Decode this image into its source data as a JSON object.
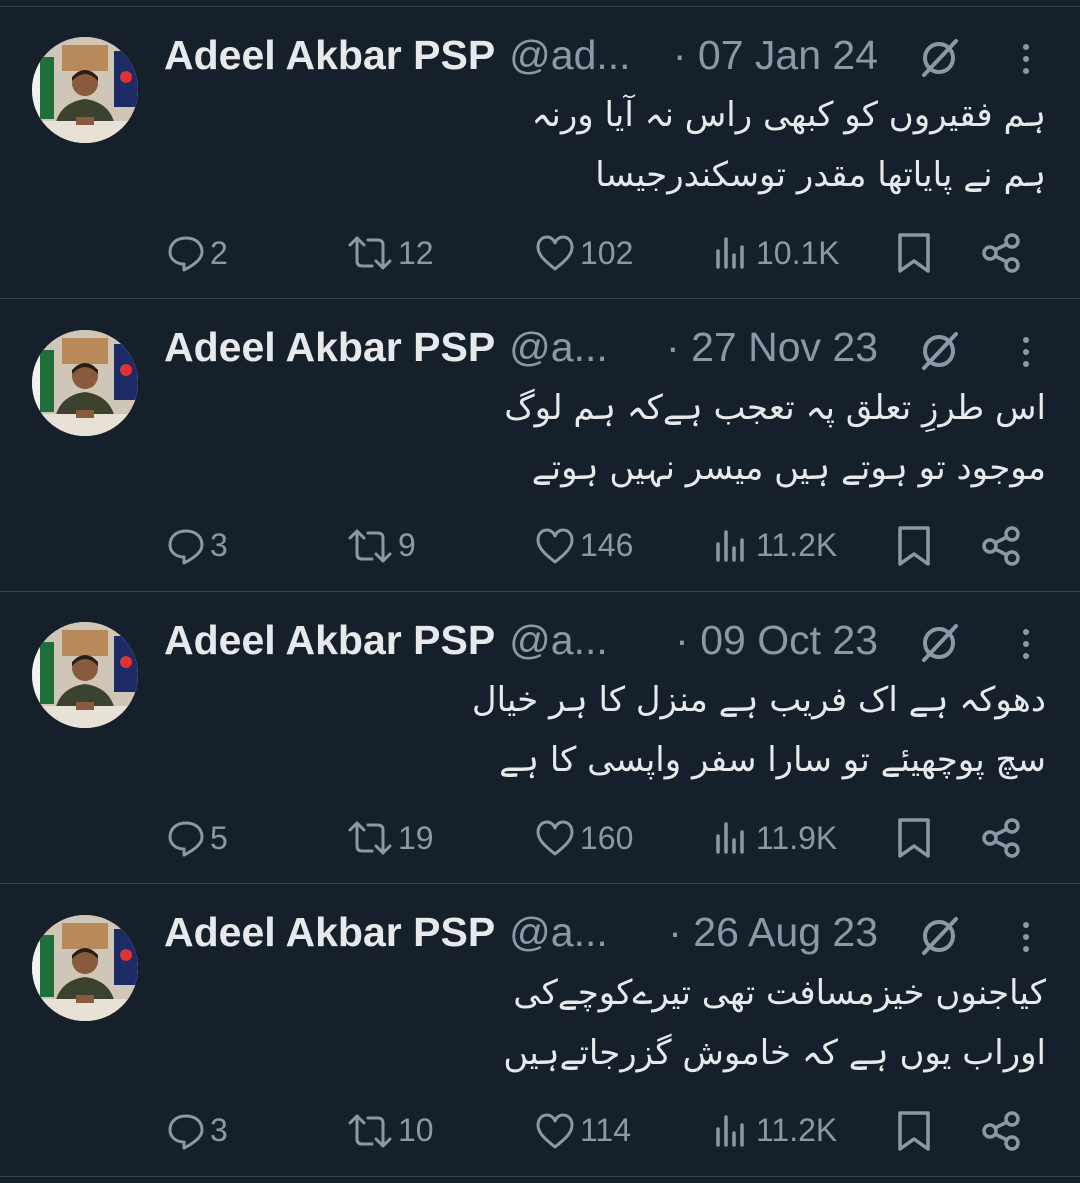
{
  "tweets": [
    {
      "name": "Adeel Akbar PSP",
      "handle": "@ad...",
      "date": "· 07 Jan 24",
      "lines": [
        "ہم فقیروں کو کبھی راس نہ آیا ورنہ",
        "ہم نے پایاتھا مقدر توسکندرجیسا"
      ],
      "replies": "2",
      "retweets": "12",
      "likes": "102",
      "views": "10.1K"
    },
    {
      "name": "Adeel Akbar PSP",
      "handle": "@a...",
      "date": "· 27 Nov 23",
      "lines": [
        "اس طرزِ تعلق پہ تعجب ہےکہ ہم لوگ",
        "موجود تو ہوتے ہیں  میسر نہیں ہوتے"
      ],
      "replies": "3",
      "retweets": "9",
      "likes": "146",
      "views": "11.2K"
    },
    {
      "name": "Adeel Akbar PSP",
      "handle": "@a...",
      "date": "· 09 Oct 23",
      "lines": [
        "دھوکہ ہے اک فریب ہے منزل کا ہر خیال",
        "سچ  پوچھیئے  تو سارا  سفر  واپسی  کا  ہے"
      ],
      "replies": "5",
      "retweets": "19",
      "likes": "160",
      "views": "11.9K"
    },
    {
      "name": "Adeel Akbar PSP",
      "handle": "@a...",
      "date": "· 26 Aug 23",
      "lines": [
        "کیاجنوں خیزمسافت تھی تیرےکوچےکی",
        "اوراب یوں ہے کہ خاموش گزرجاتےہیں"
      ],
      "replies": "3",
      "retweets": "10",
      "likes": "114",
      "views": "11.2K"
    }
  ],
  "colors": {
    "background": "#15202b",
    "text": "#e7e9ea",
    "muted": "#8b98a5",
    "divider": "#38444d"
  },
  "icons": [
    "reply-icon",
    "retweet-icon",
    "like-icon",
    "views-icon",
    "bookmark-icon",
    "share-icon",
    "grok-icon",
    "more-icon"
  ]
}
